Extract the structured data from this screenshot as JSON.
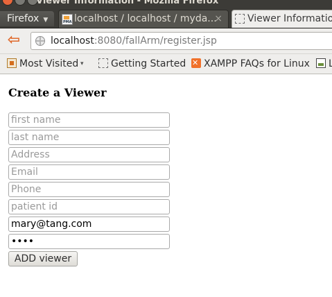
{
  "window": {
    "title": "Viewer Information - Mozilla Firefox"
  },
  "tabbar": {
    "app_menu_label": "Firefox",
    "tabs": [
      {
        "label": "localhost / localhost / myda...",
        "state": "inactive",
        "icon": "phpmyadmin-icon",
        "icon_text": "PMA",
        "close_glyph": "×"
      },
      {
        "label": "Viewer Information",
        "state": "active",
        "icon": "blank-page-icon"
      }
    ]
  },
  "navbar": {
    "back_glyph": "⇦",
    "url_host": "localhost",
    "url_rest": ":8080/fallArm/register.jsp"
  },
  "bookmarks": [
    {
      "label": "Most Visited",
      "has_dropdown": true,
      "icon": "most-visited-icon",
      "dropdown_glyph": "▾"
    },
    {
      "label": "Getting Started",
      "icon": "blank-page-icon"
    },
    {
      "label": "XAMPP FAQs for Linux",
      "icon": "xampp-icon"
    },
    {
      "label": "L",
      "icon": "image-icon"
    }
  ],
  "form": {
    "title": "Create a Viewer",
    "fields": [
      {
        "name": "first-name",
        "placeholder": "first name",
        "value": "",
        "type": "text"
      },
      {
        "name": "last-name",
        "placeholder": "last name",
        "value": "",
        "type": "text"
      },
      {
        "name": "address",
        "placeholder": "Address",
        "value": "",
        "type": "text"
      },
      {
        "name": "email",
        "placeholder": "Email",
        "value": "",
        "type": "text"
      },
      {
        "name": "phone",
        "placeholder": "Phone",
        "value": "",
        "type": "text"
      },
      {
        "name": "patient-id",
        "placeholder": "patient id",
        "value": "",
        "type": "text"
      },
      {
        "name": "username",
        "placeholder": "",
        "value": "mary@tang.com",
        "type": "text"
      },
      {
        "name": "password",
        "placeholder": "",
        "value": "abcd",
        "type": "password"
      }
    ],
    "submit_label": "ADD viewer"
  },
  "colors": {
    "chrome_dark": "#3c3b37",
    "toolbar": "#efeeec",
    "back_arrow": "#e06a2c"
  }
}
